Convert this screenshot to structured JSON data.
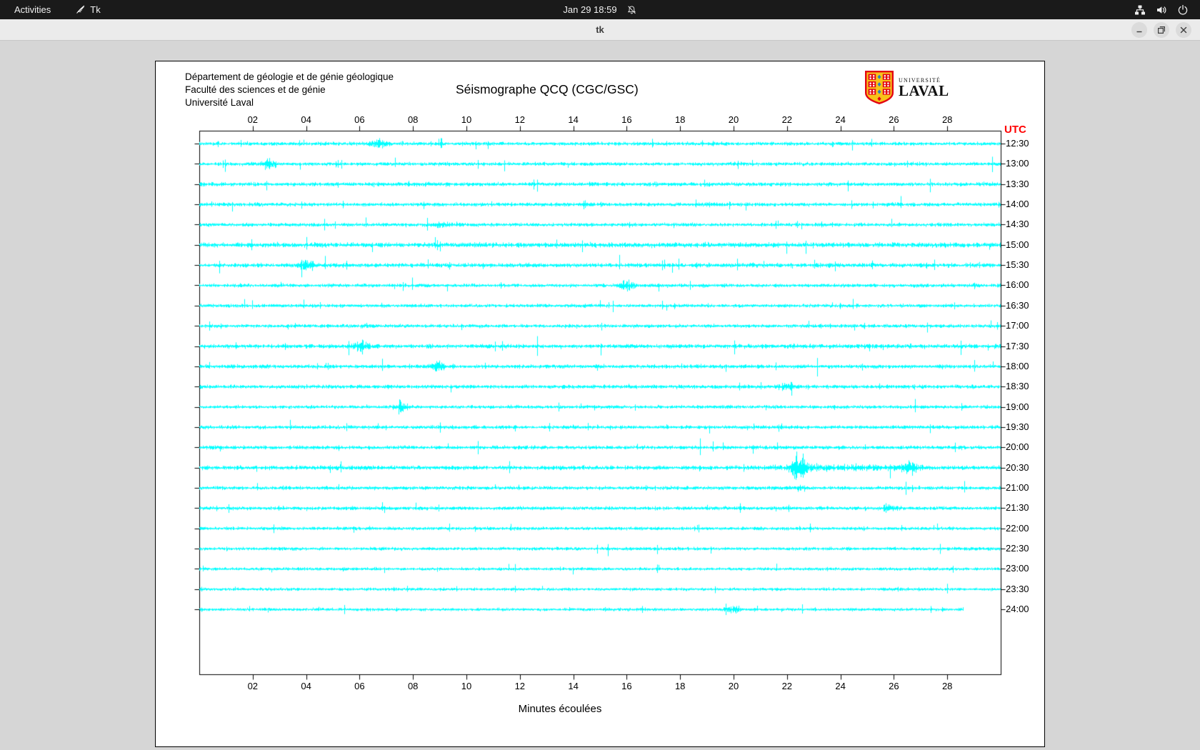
{
  "topbar": {
    "activities": "Activities",
    "app_name": "Tk",
    "clock": "Jan 29 18:59"
  },
  "window": {
    "title": "tk"
  },
  "canvas": {
    "header": {
      "line1": "Département de géologie et de génie géologique",
      "line2": "Faculté des sciences et de génie",
      "line3": "Université Laval"
    },
    "title": "Séismographe QCQ (CGC/GSC)",
    "utc_label": "UTC",
    "xlabel": "Minutes écoulées",
    "logo": {
      "line1": "UNIVERSITÉ",
      "line2": "LAVAL"
    }
  },
  "colors": {
    "trace": "#00ffff",
    "axis": "#000000",
    "utc": "#ff0000",
    "logo_red": "#e30513",
    "logo_gold": "#f7c21a",
    "logo_blue": "#2a7fc1"
  },
  "chart_data": {
    "type": "line",
    "subtype": "helicorder-seismogram",
    "title": "Séismographe QCQ (CGC/GSC)",
    "xlabel": "Minutes écoulées",
    "right_axis_title": "UTC",
    "x_range_minutes": [
      0,
      30
    ],
    "x_tick_minutes": [
      2,
      4,
      6,
      8,
      10,
      12,
      14,
      16,
      18,
      20,
      22,
      24,
      26,
      28
    ],
    "x_tick_labels": [
      "02",
      "04",
      "06",
      "08",
      "10",
      "12",
      "14",
      "16",
      "18",
      "20",
      "22",
      "24",
      "26",
      "28"
    ],
    "row_duration_minutes": 30,
    "trace_color": "#00ffff",
    "grid": false,
    "rows": [
      {
        "time": "12:30",
        "activity": 1.0,
        "events": [
          [
            6.7,
            2.5
          ]
        ]
      },
      {
        "time": "13:00",
        "activity": 1.0,
        "events": [
          [
            2.6,
            2.5
          ]
        ]
      },
      {
        "time": "13:30",
        "activity": 1.15,
        "events": []
      },
      {
        "time": "14:00",
        "activity": 1.05,
        "events": []
      },
      {
        "time": "14:30",
        "activity": 1.0,
        "events": [
          [
            9,
            2
          ]
        ]
      },
      {
        "time": "15:00",
        "activity": 1.45,
        "events": []
      },
      {
        "time": "15:30",
        "activity": 1.25,
        "events": [
          [
            4,
            2.5
          ]
        ]
      },
      {
        "time": "16:00",
        "activity": 1.0,
        "events": [
          [
            16,
            3
          ]
        ]
      },
      {
        "time": "16:30",
        "activity": 0.95,
        "events": []
      },
      {
        "time": "17:00",
        "activity": 1.0,
        "events": []
      },
      {
        "time": "17:30",
        "activity": 1.25,
        "events": [
          [
            6,
            2
          ]
        ]
      },
      {
        "time": "18:00",
        "activity": 1.1,
        "events": [
          [
            8.9,
            2
          ]
        ]
      },
      {
        "time": "18:30",
        "activity": 1.1,
        "events": [
          [
            22,
            1.5
          ]
        ]
      },
      {
        "time": "19:00",
        "activity": 0.95,
        "events": [
          [
            7.5,
            3.5
          ]
        ]
      },
      {
        "time": "19:30",
        "activity": 1.0,
        "events": []
      },
      {
        "time": "20:00",
        "activity": 1.05,
        "events": []
      },
      {
        "time": "20:30",
        "activity": 1.2,
        "events": [
          [
            22.4,
            4.5
          ],
          [
            26.6,
            2.5
          ],
          [
            24,
            0.9,
            0.15
          ]
        ]
      },
      {
        "time": "21:00",
        "activity": 1.0,
        "events": [
          [
            22.4,
            1.5
          ]
        ]
      },
      {
        "time": "21:30",
        "activity": 1.0,
        "events": [
          [
            25.8,
            2
          ]
        ]
      },
      {
        "time": "22:00",
        "activity": 0.9,
        "events": []
      },
      {
        "time": "22:30",
        "activity": 0.9,
        "events": []
      },
      {
        "time": "23:00",
        "activity": 0.85,
        "events": []
      },
      {
        "time": "23:30",
        "activity": 0.8,
        "events": []
      },
      {
        "time": "24:00",
        "activity": 0.8,
        "events": [
          [
            20,
            2
          ]
        ],
        "end_minute": 28.6
      }
    ]
  }
}
